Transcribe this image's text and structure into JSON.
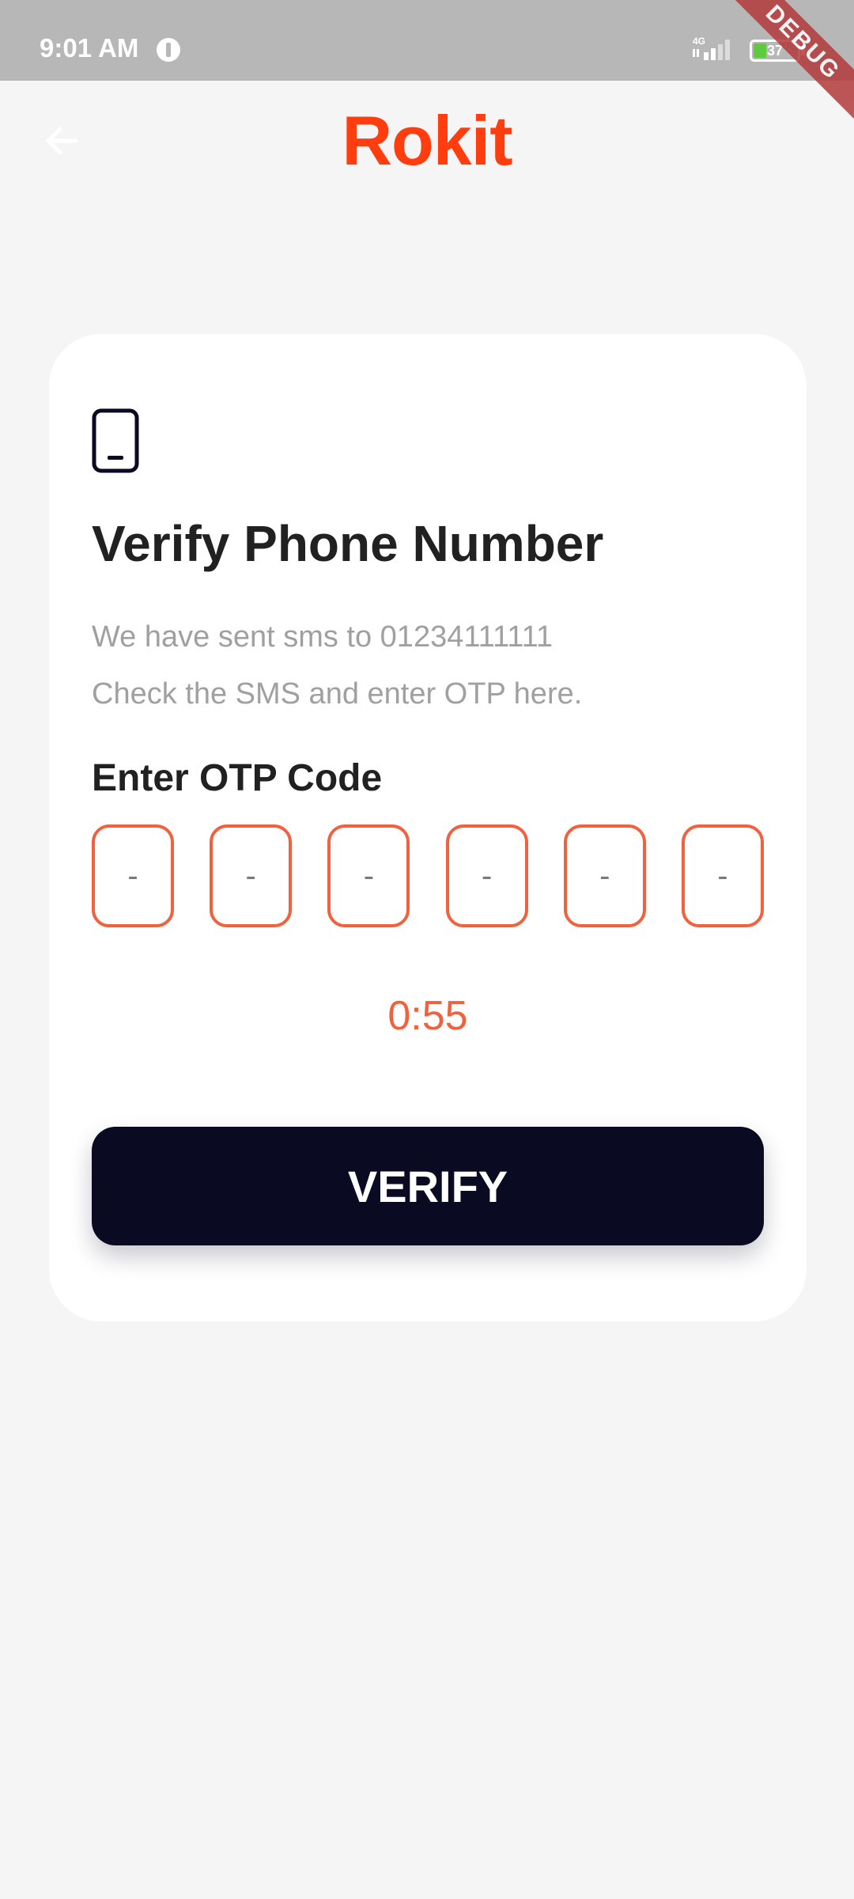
{
  "status_bar": {
    "time": "9:01 AM",
    "network": "4G",
    "battery": "37",
    "debug_label": "DEBUG"
  },
  "header": {
    "logo": "Rokit",
    "back_icon": "arrow-left-icon"
  },
  "card": {
    "icon": "smartphone-icon",
    "title": "Verify Phone Number",
    "desc_line1": "We have sent sms to 01234111111",
    "desc_line2": "Check the SMS and enter OTP here.",
    "otp_label": "Enter OTP Code",
    "otp_digits": [
      "-",
      "-",
      "-",
      "-",
      "-",
      "-"
    ],
    "timer": "0:55",
    "verify_label": "VERIFY"
  },
  "colors": {
    "brand": "#ff3d0f",
    "accent": "#f0613d",
    "button_bg": "#0a0a23",
    "page_bg": "#f5f5f5",
    "status_bar_bg": "#b7b7b7"
  }
}
